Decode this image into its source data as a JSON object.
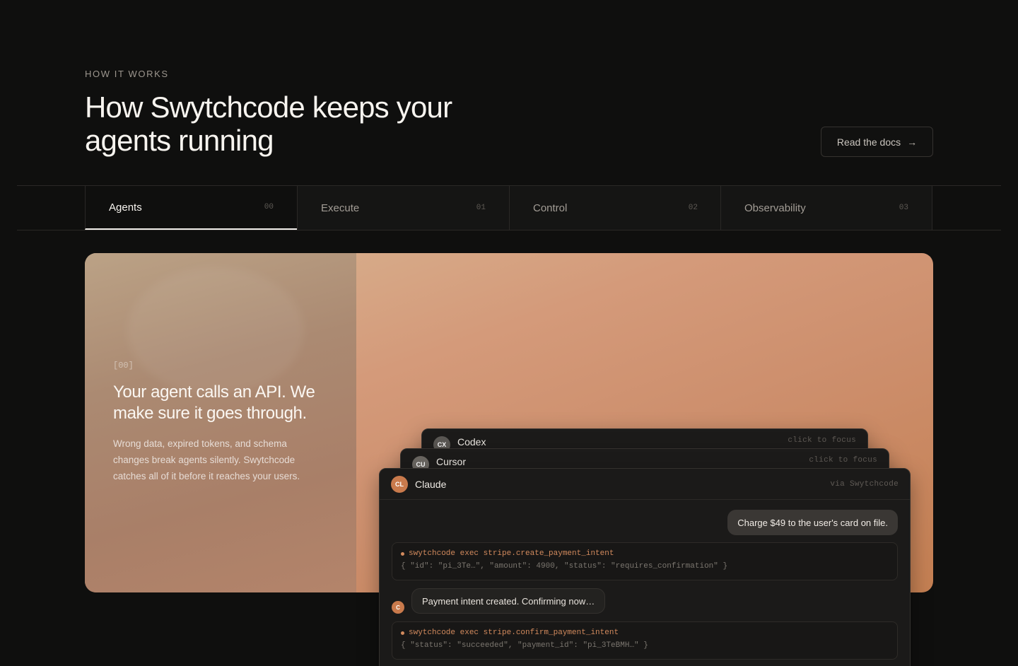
{
  "section": {
    "eyebrow": "HOW IT WORKS",
    "title": "How Swytchcode keeps your agents running",
    "docs_button": "Read the docs"
  },
  "tabs": [
    {
      "label": "Agents",
      "number": "00",
      "active": true
    },
    {
      "label": "Execute",
      "number": "01",
      "active": false
    },
    {
      "label": "Control",
      "number": "02",
      "active": false
    },
    {
      "label": "Observability",
      "number": "03",
      "active": false
    }
  ],
  "hero": {
    "code": "[00]",
    "heading": "Your agent calls an API. We make sure it goes through.",
    "body": "Wrong data, expired tokens, and schema changes break agents silently. Swytchcode catches all of it before it reaches your users."
  },
  "cards": {
    "codex": {
      "badge": "CX",
      "name": "Codex",
      "hint": "click to focus"
    },
    "cursor": {
      "badge": "CU",
      "name": "Cursor",
      "hint": "click to focus"
    },
    "claude": {
      "badge": "CL",
      "name": "Claude",
      "hint": "via Swytchcode"
    }
  },
  "conversation": {
    "user_message": "Charge $49 to the user's card on file.",
    "tool_1": {
      "command": "swytchcode exec stripe.create_payment_intent",
      "result": "{ \"id\": \"pi_3Te…\", \"amount\": 4900, \"status\": \"requires_confirmation\" }"
    },
    "assistant_avatar": "C",
    "assistant_message": "Payment intent created. Confirming now…",
    "tool_2": {
      "command": "swytchcode exec stripe.confirm_payment_intent",
      "result": "{ \"status\": \"succeeded\", \"payment_id\": \"pi_3TeBMH…\" }"
    }
  },
  "colors": {
    "background": "#0f0f0e",
    "accent": "#d28a5d",
    "hero_gradient_start": "#d9b693",
    "hero_gradient_end": "#c47f52"
  },
  "icons": {
    "docs_arrow": "arrow-right-icon"
  }
}
